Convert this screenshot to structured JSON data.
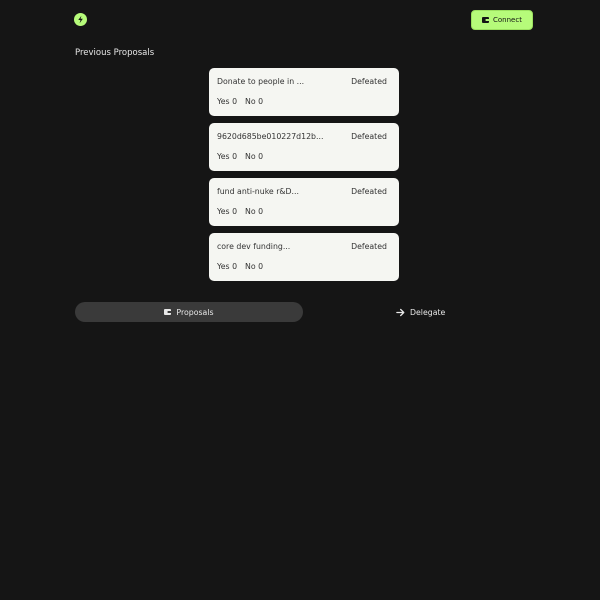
{
  "header": {
    "logo_icon": "bolt-icon",
    "connect_label": "Connect",
    "connect_icon": "wallet-icon",
    "accent_color": "#b6fb7a"
  },
  "section": {
    "title": "Previous Proposals"
  },
  "proposals": [
    {
      "title": "Donate to people in ...",
      "status": "Defeated",
      "yes": "Yes 0",
      "no": "No 0"
    },
    {
      "title": "9620d685be010227d12b...",
      "status": "Defeated",
      "yes": "Yes 0",
      "no": "No 0"
    },
    {
      "title": "fund anti-nuke r&D...",
      "status": "Defeated",
      "yes": "Yes 0",
      "no": "No 0"
    },
    {
      "title": "core dev funding...",
      "status": "Defeated",
      "yes": "Yes 0",
      "no": "No 0"
    }
  ],
  "nav": {
    "proposals_label": "Proposals",
    "proposals_icon": "wallet-icon",
    "delegate_label": "Delegate",
    "delegate_icon": "arrow-right-icon"
  }
}
